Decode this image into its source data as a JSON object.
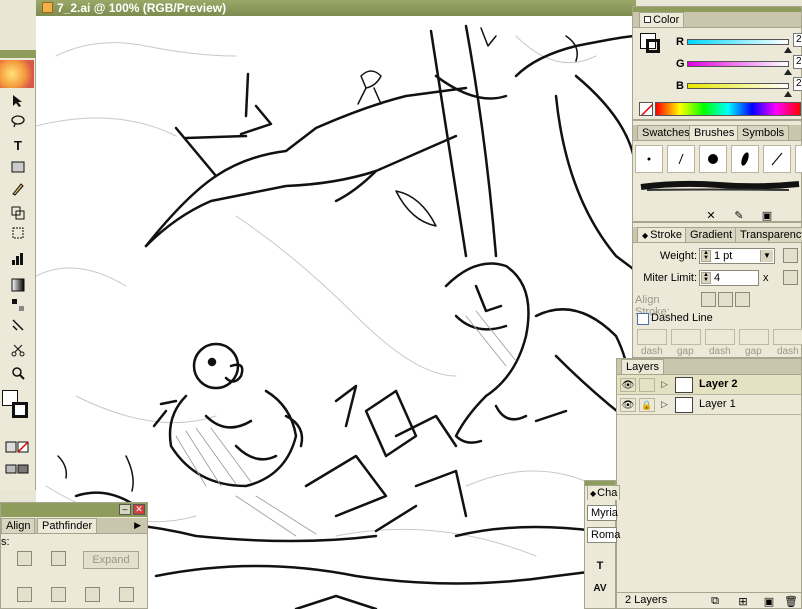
{
  "document": {
    "title": "7_2.ai @ 100% (RGB/Preview)"
  },
  "color_panel": {
    "tab": "Color",
    "channels": [
      {
        "letter": "R",
        "value": "2",
        "level": 0.99
      },
      {
        "letter": "G",
        "value": "2",
        "level": 0.99
      },
      {
        "letter": "B",
        "value": "2",
        "level": 0.99
      }
    ]
  },
  "brushes_panel": {
    "tabs": [
      "Swatches",
      "Brushes",
      "Symbols"
    ],
    "active_tab": "Brushes"
  },
  "stroke_panel": {
    "tabs": [
      "Stroke",
      "Gradient",
      "Transparency"
    ],
    "weight_label": "Weight:",
    "weight_value": "1 pt",
    "miter_label": "Miter Limit:",
    "miter_value": "4",
    "miter_unit": "x",
    "align_stroke_label": "Align Stroke:",
    "dashed_line_label": "Dashed Line",
    "dash_labels": [
      "dash",
      "gap",
      "dash",
      "gap",
      "dash"
    ]
  },
  "layers_panel": {
    "tab": "Layers",
    "layers": [
      {
        "name": "Layer 2",
        "selected": true
      },
      {
        "name": "Layer 1",
        "selected": false
      }
    ],
    "count_label": "2 Layers"
  },
  "pathfinder_panel": {
    "tabs": [
      "Align",
      "Pathfinder"
    ],
    "expand_label": "Expand",
    "row_label": "s:"
  },
  "character_panel": {
    "tab": "Cha",
    "font_family": "Myria",
    "font_style": "Roma"
  },
  "colors": {
    "title_bar": "#8e9c5c",
    "panel_bg": "#ece9d8",
    "workspace": "#e9e6d6"
  }
}
